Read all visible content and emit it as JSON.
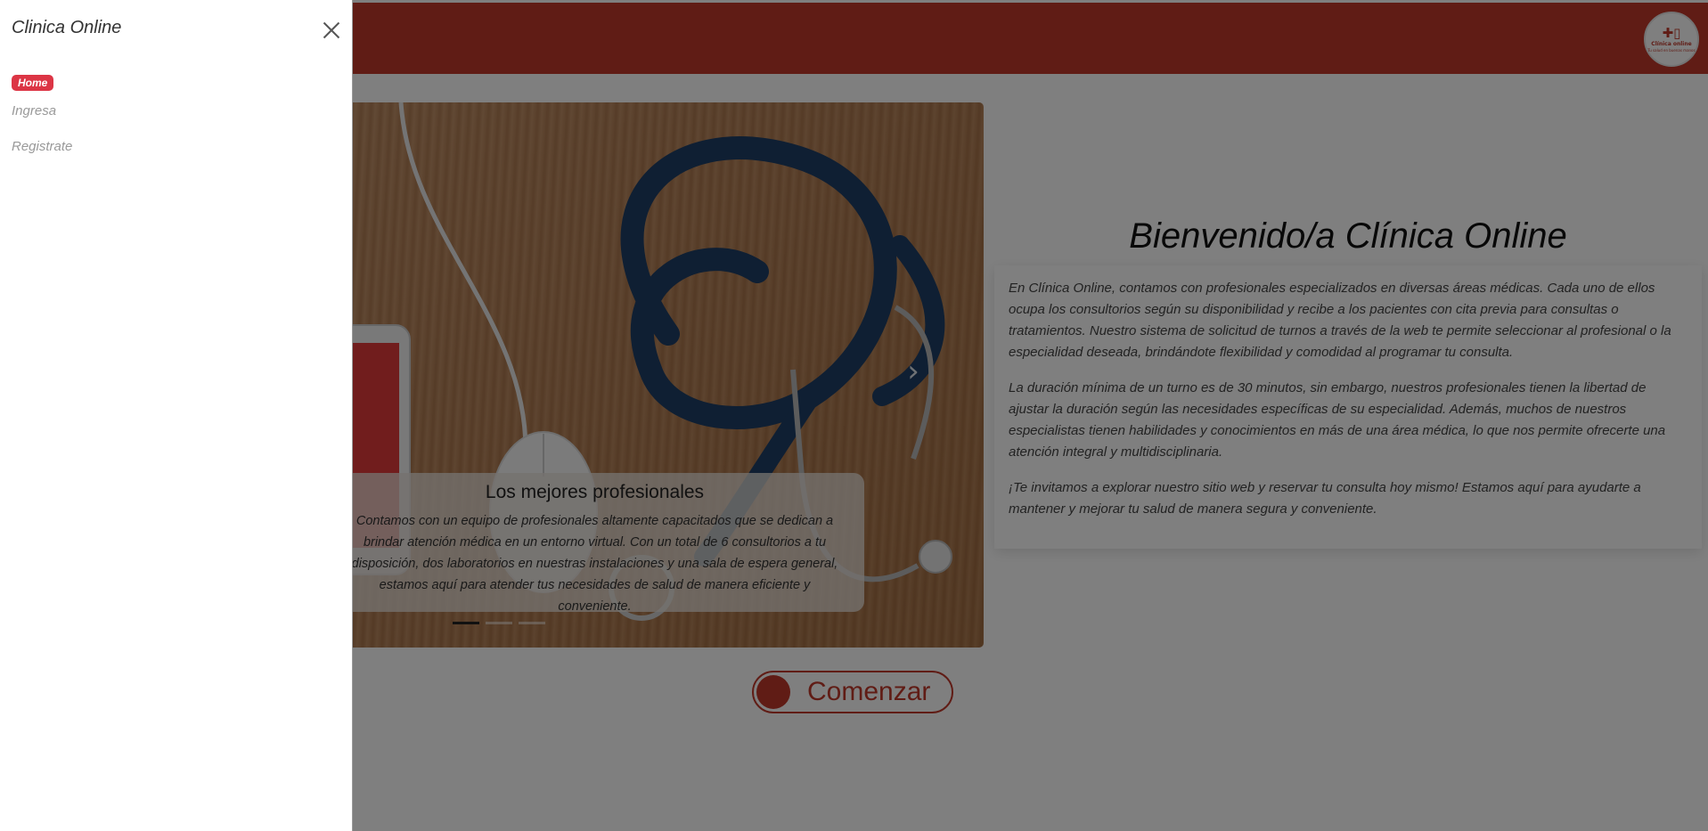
{
  "header": {
    "logo": {
      "text": "Clínica online",
      "subtext": "Tu salud en buenas manos",
      "icon": "medical-cross-icon"
    }
  },
  "carousel": {
    "slide_caption_title": "Los mejores profesionales",
    "slide_caption_text": "Contamos con un equipo de profesionales altamente capacitados que se dedican a brindar atención médica en un entorno virtual. Con un total de 6 consultorios a tu disposición, dos laboratorios en nuestras instalaciones y una sala de espera general, estamos aquí para atender tus necesidades de salud de manera eficiente y conveniente.",
    "indicators": 3,
    "active_indicator": 0,
    "next_icon": "chevron-right-icon"
  },
  "welcome": {
    "title": "Bienvenido/a Clínica Online",
    "paragraphs": [
      "En Clínica Online, contamos con profesionales especializados en diversas áreas médicas. Cada uno de ellos ocupa los consultorios según su disponibilidad y recibe a los pacientes con cita previa para consultas o tratamientos. Nuestro sistema de solicitud de turnos a través de la web te permite seleccionar al profesional o la especialidad deseada, brindándote flexibilidad y comodidad al programar tu consulta.",
      "La duración mínima de un turno es de 30 minutos, sin embargo, nuestros profesionales tienen la libertad de ajustar la duración según las necesidades específicas de su especialidad. Además, muchos de nuestros especialistas tienen habilidades y conocimientos en más de una área médica, lo que nos permite ofrecerte una atención integral y multidisciplinaria.",
      "¡Te invitamos a explorar nuestro sitio web y reservar tu consulta hoy mismo! Estamos aquí para ayudarte a mantener y mejorar tu salud de manera segura y conveniente."
    ]
  },
  "cta": {
    "label": "Comenzar"
  },
  "drawer": {
    "title": "Clinica Online",
    "close_icon": "close-icon",
    "nav": [
      {
        "label": "Home",
        "active": true
      },
      {
        "label": "Ingresa",
        "active": false
      },
      {
        "label": "Registrate",
        "active": false
      }
    ]
  },
  "colors": {
    "brand": "#c0392b",
    "active_nav": "#dc3545",
    "overlay": "rgba(0,0,0,0.5)"
  }
}
